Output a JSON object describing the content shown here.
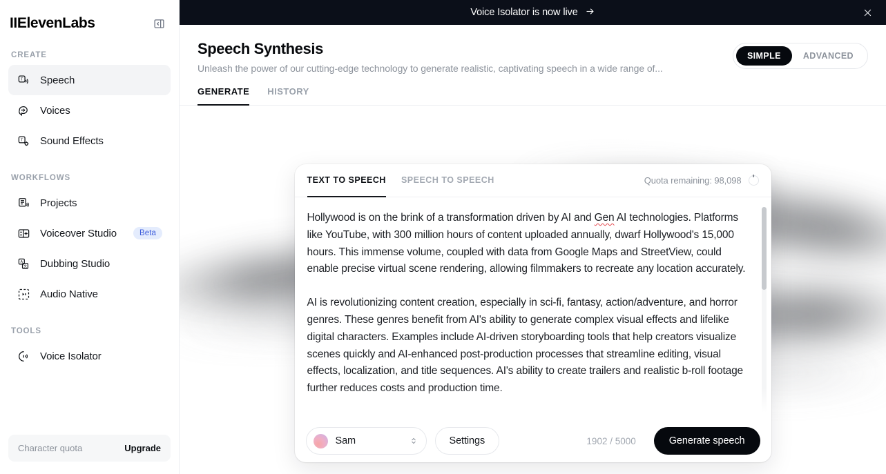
{
  "sidebar": {
    "brand": "IIElevenLabs",
    "collapse_icon": "panel-collapse-icon",
    "groups": [
      {
        "label": "CREATE",
        "items": [
          {
            "label": "Speech",
            "icon": "text-to-speech-icon",
            "active": true
          },
          {
            "label": "Voices",
            "icon": "voices-bubble-icon",
            "active": false
          },
          {
            "label": "Sound Effects",
            "icon": "sound-effects-icon",
            "active": false
          }
        ]
      },
      {
        "label": "WORKFLOWS",
        "items": [
          {
            "label": "Projects",
            "icon": "projects-icon",
            "active": false
          },
          {
            "label": "Voiceover Studio",
            "icon": "voiceover-studio-icon",
            "badge": "Beta",
            "active": false
          },
          {
            "label": "Dubbing Studio",
            "icon": "dubbing-studio-icon",
            "active": false
          },
          {
            "label": "Audio Native",
            "icon": "audio-native-icon",
            "active": false
          }
        ]
      },
      {
        "label": "TOOLS",
        "items": [
          {
            "label": "Voice Isolator",
            "icon": "voice-isolator-icon",
            "active": false
          }
        ]
      }
    ],
    "quota_label": "Character quota",
    "upgrade_label": "Upgrade"
  },
  "banner": {
    "text": "Voice Isolator is now live",
    "arrow_icon": "arrow-right-icon",
    "close_icon": "close-icon",
    "background": "#0b0f19"
  },
  "header": {
    "title": "Speech Synthesis",
    "subtitle": "Unleash the power of our cutting-edge technology to generate realistic, captivating speech in a wide range of...",
    "mode_toggle": {
      "options": [
        "SIMPLE",
        "ADVANCED"
      ],
      "selected": "SIMPLE"
    }
  },
  "page_tabs": {
    "items": [
      "GENERATE",
      "HISTORY"
    ],
    "selected": "GENERATE"
  },
  "card": {
    "tabs": {
      "items": [
        "TEXT TO SPEECH",
        "SPEECH TO SPEECH"
      ],
      "selected": "TEXT TO SPEECH"
    },
    "quota_remaining_label": "Quota remaining: 98,098",
    "quota_ring_icon": "quota-ring-icon",
    "editor": {
      "paragraph_1_a": "Hollywood is on the brink of a transformation driven by AI and ",
      "paragraph_1_spell": "Gen",
      "paragraph_1_b": " AI technologies. Platforms like YouTube, with 300 million hours of content uploaded annually, dwarf Hollywood's 15,000 hours. This immense volume, coupled with data from Google Maps and StreetView, could enable precise virtual scene rendering, allowing filmmakers to recreate any location accurately.",
      "paragraph_2": "AI is revolutionizing content creation, especially in sci-fi, fantasy, action/adventure, and horror genres. These genres benefit from AI's ability to generate complex visual effects and lifelike digital characters. Examples include AI-driven storyboarding tools that help creators visualize scenes quickly and AI-enhanced post-production processes that streamline editing, visual effects, localization, and title sequences. AI's ability to create trailers and realistic b-roll footage further reduces costs and production time."
    },
    "footer": {
      "voice_name": "Sam",
      "voice_avatar_icon": "voice-avatar-icon",
      "voice_chevron_icon": "chevron-up-down-icon",
      "settings_label": "Settings",
      "character_count": "1902 / 5000",
      "generate_label": "Generate speech"
    }
  }
}
